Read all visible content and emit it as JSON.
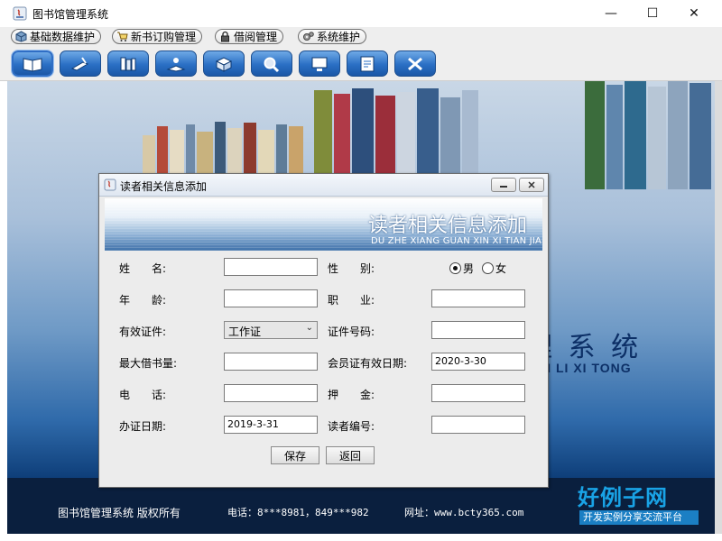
{
  "window": {
    "title": "图书馆管理系统",
    "minimize": "—",
    "maximize": "☐",
    "close": "✕"
  },
  "menu": [
    {
      "label": "基础数据维护",
      "icon": "cube-icon"
    },
    {
      "label": "新书订购管理",
      "icon": "cart-icon"
    },
    {
      "label": "借阅管理",
      "icon": "lock-icon"
    },
    {
      "label": "系统维护",
      "icon": "gears-icon"
    }
  ],
  "toolbar": [
    "open-book-icon",
    "pen-icon",
    "books-icon",
    "reader-icon",
    "box-icon",
    "search-icon",
    "computer-icon",
    "form-icon",
    "exit-icon"
  ],
  "background": {
    "brand": "理 系 统",
    "brand_sub": "N LI XI TONG",
    "footer_left": "图书馆管理系统  版权所有",
    "footer_phone": "电话：8***8981，849***982",
    "footer_site": "网址：www.bcty365.com",
    "logo_big": "好例子网",
    "logo_small": "开发实例分享交流平台"
  },
  "dialog": {
    "title": "读者相关信息添加",
    "banner_title": "读者相关信息添加",
    "banner_sub": "DU ZHE XIANG GUAN XIN XI TIAN JIA",
    "labels": {
      "name": "姓　　名:",
      "gender": "性　　别:",
      "age": "年　　龄:",
      "job": "职　　业:",
      "id_type": "有效证件:",
      "id_number": "证件号码:",
      "max_borrow": "最大借书量:",
      "card_expiry": "会员证有效日期:",
      "phone": "电　　话:",
      "deposit": "押　　金:",
      "issue_date": "办证日期:",
      "reader_no": "读者编号:"
    },
    "values": {
      "name": "",
      "age": "",
      "job": "",
      "id_type": "工作证",
      "id_number": "",
      "max_borrow": "",
      "card_expiry": "2020-3-30",
      "phone": "",
      "deposit": "",
      "issue_date": "2019-3-31",
      "reader_no": ""
    },
    "gender_options": [
      "男",
      "女"
    ],
    "gender_selected": "男",
    "buttons": {
      "save": "保存",
      "back": "返回"
    }
  }
}
